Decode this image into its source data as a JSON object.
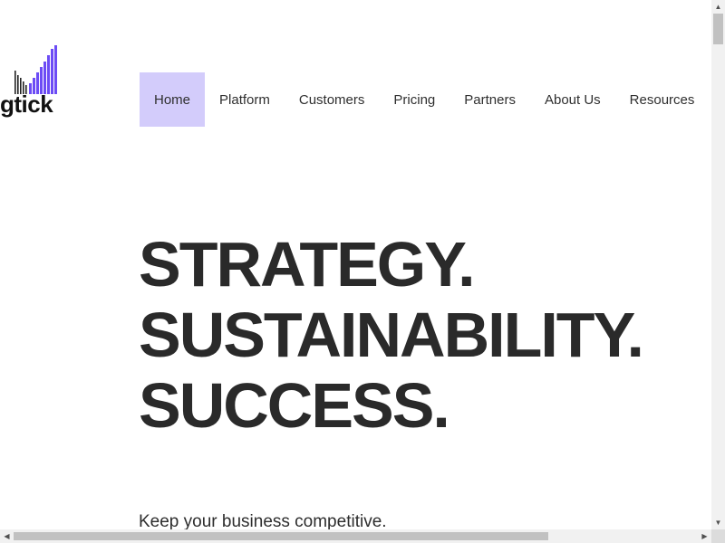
{
  "logo": {
    "text": "gtick",
    "bar_color": "#6c4cf5"
  },
  "nav": {
    "items": [
      {
        "label": "Home",
        "active": true
      },
      {
        "label": "Platform"
      },
      {
        "label": "Customers"
      },
      {
        "label": "Pricing"
      },
      {
        "label": "Partners"
      },
      {
        "label": "About Us"
      },
      {
        "label": "Resources"
      }
    ],
    "active_color": "#d3ccfb"
  },
  "hero": {
    "lines": [
      "STRATEGY.",
      "SUSTAINABILITY.",
      "SUCCESS."
    ],
    "tagline": "Keep your business competitive."
  },
  "scrollbars": {
    "up_icon": "triangle-up-icon",
    "down_icon": "triangle-down-icon",
    "left_icon": "triangle-left-icon",
    "right_icon": "triangle-right-icon"
  }
}
